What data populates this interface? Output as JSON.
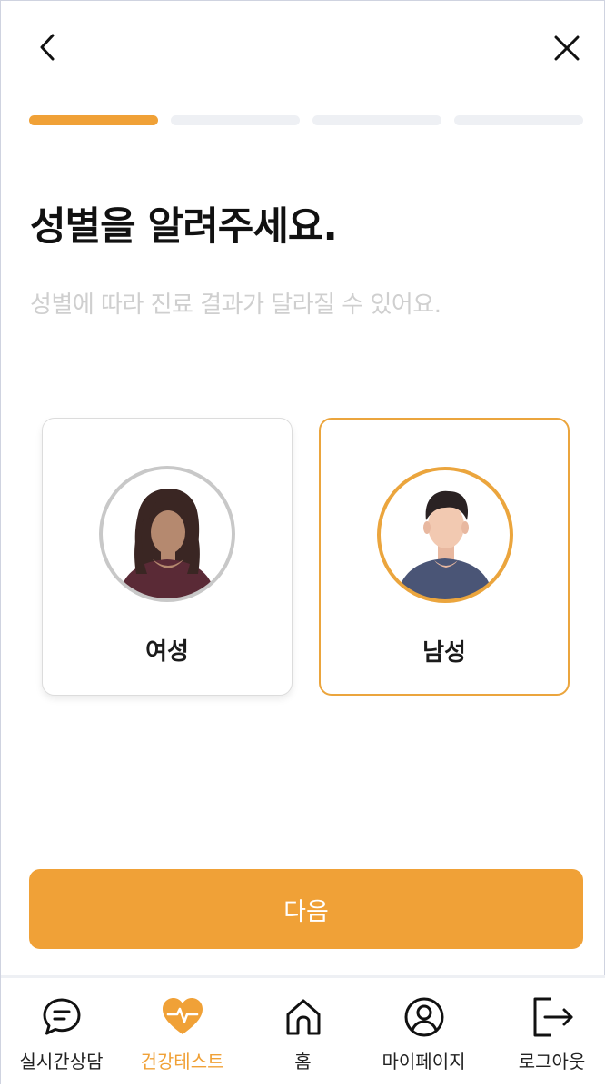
{
  "header": {
    "back_icon": "chevron-left-icon",
    "close_icon": "close-icon"
  },
  "progress": {
    "current_step": 1,
    "total_steps": 4,
    "active_color": "#f0a137"
  },
  "title": "성별을 알려주세요.",
  "subtitle": "성별에 따라 진료 결과가 달라질 수 있어요.",
  "options": [
    {
      "label": "여성",
      "selected": false,
      "icon": "female-avatar-icon"
    },
    {
      "label": "남성",
      "selected": true,
      "icon": "male-avatar-icon"
    }
  ],
  "next_button": "다음",
  "tabs": [
    {
      "label": "실시간상담",
      "icon": "chat-icon",
      "active": false
    },
    {
      "label": "건강테스트",
      "icon": "heartbeat-icon",
      "active": true
    },
    {
      "label": "홈",
      "icon": "home-icon",
      "active": false
    },
    {
      "label": "마이페이지",
      "icon": "user-icon",
      "active": false
    },
    {
      "label": "로그아웃",
      "icon": "logout-icon",
      "active": false
    }
  ],
  "colors": {
    "accent": "#f0a137",
    "selected_border": "#eba53d",
    "muted_text": "#cfcfcf"
  }
}
